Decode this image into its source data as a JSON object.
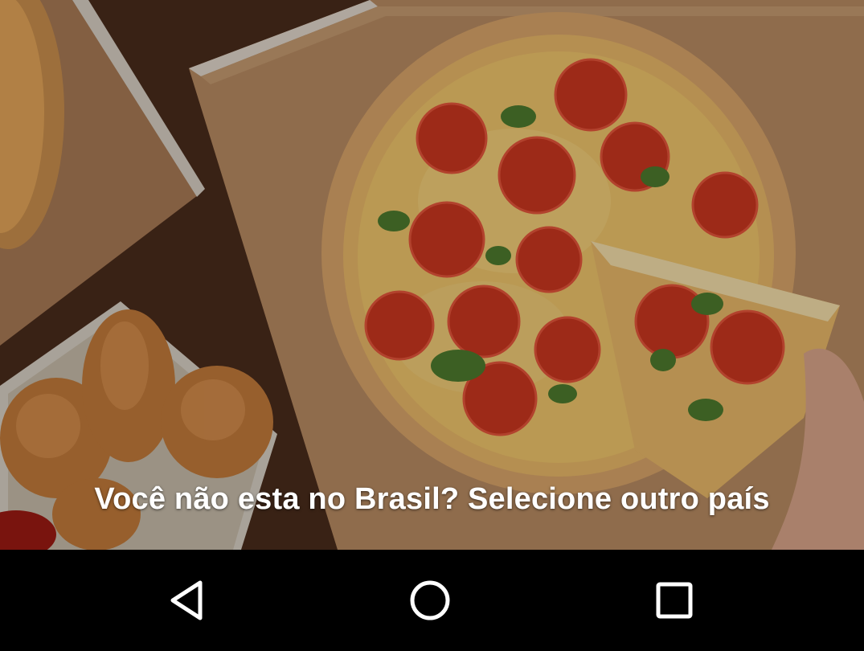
{
  "hero": {
    "country_prompt": "Você não esta no Brasil? Selecione outro país"
  },
  "navbar": {
    "back_icon": "back-triangle-icon",
    "home_icon": "home-circle-icon",
    "recents_icon": "recents-square-icon"
  },
  "colors": {
    "text": "#ffffff",
    "navbar_background": "#000000",
    "nav_icon": "#ffffff"
  }
}
